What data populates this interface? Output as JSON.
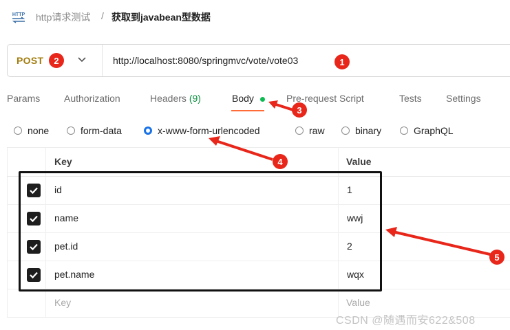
{
  "header": {
    "icon_text": "HTTP",
    "breadcrumb_parent": "http请求测试",
    "breadcrumb_separator": "/",
    "title": "获取到javabean型数据"
  },
  "request": {
    "method": "POST",
    "url": "http://localhost:8080/springmvc/vote/vote03"
  },
  "tabs": [
    {
      "label": "Params"
    },
    {
      "label": "Authorization"
    },
    {
      "label": "Headers",
      "count": "(9)"
    },
    {
      "label": "Body"
    },
    {
      "label": "Pre-request Script"
    },
    {
      "label": "Tests"
    },
    {
      "label": "Settings"
    }
  ],
  "active_tab": "Body",
  "body_types": [
    {
      "label": "none",
      "selected": false
    },
    {
      "label": "form-data",
      "selected": false
    },
    {
      "label": "x-www-form-urlencoded",
      "selected": true
    },
    {
      "label": "raw",
      "selected": false
    },
    {
      "label": "binary",
      "selected": false
    },
    {
      "label": "GraphQL",
      "selected": false
    }
  ],
  "table": {
    "headers": {
      "key": "Key",
      "value": "Value"
    },
    "rows": [
      {
        "checked": true,
        "key": "id",
        "value": "1"
      },
      {
        "checked": true,
        "key": "name",
        "value": "wwj"
      },
      {
        "checked": true,
        "key": "pet.id",
        "value": "2"
      },
      {
        "checked": true,
        "key": "pet.name",
        "value": "wqx"
      }
    ],
    "placeholder": {
      "key": "Key",
      "value": "Value"
    }
  },
  "annotations": [
    "1",
    "2",
    "3",
    "4",
    "5"
  ],
  "colors": {
    "method": "#a17b0c",
    "accent": "#ff6c37",
    "radio_selected": "#1a73e8",
    "body_dot": "#0cbb52",
    "marker": "#e8261a"
  },
  "watermark": "CSDN @随遇而安622&508"
}
